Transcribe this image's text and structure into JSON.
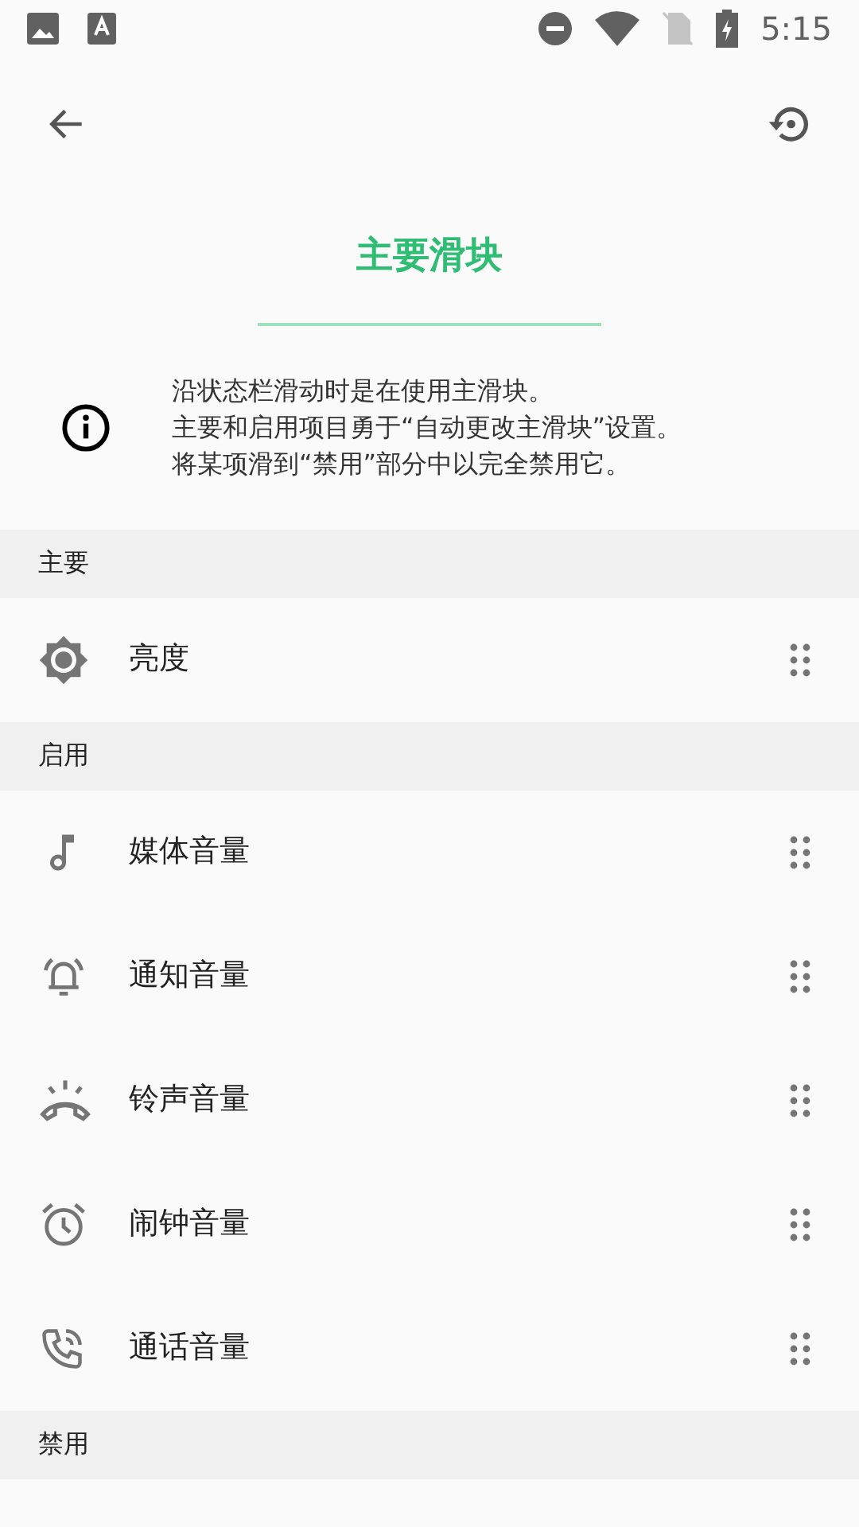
{
  "status_bar": {
    "time": "5:15"
  },
  "title": "主要滑块",
  "info": {
    "lines": [
      "沿状态栏滑动时是在使用主滑块。",
      "主要和启用项目勇于“自动更改主滑块”设置。",
      "将某项滑到“禁用”部分中以完全禁用它。"
    ]
  },
  "sections": [
    {
      "header": "主要",
      "items": [
        {
          "kind": "brightness",
          "label": "亮度"
        }
      ]
    },
    {
      "header": "启用",
      "items": [
        {
          "kind": "media",
          "label": "媒体音量"
        },
        {
          "kind": "notification",
          "label": "通知音量"
        },
        {
          "kind": "ring",
          "label": "铃声音量"
        },
        {
          "kind": "alarm",
          "label": "闹钟音量"
        },
        {
          "kind": "call",
          "label": "通话音量"
        }
      ]
    },
    {
      "header": "禁用"
    }
  ]
}
